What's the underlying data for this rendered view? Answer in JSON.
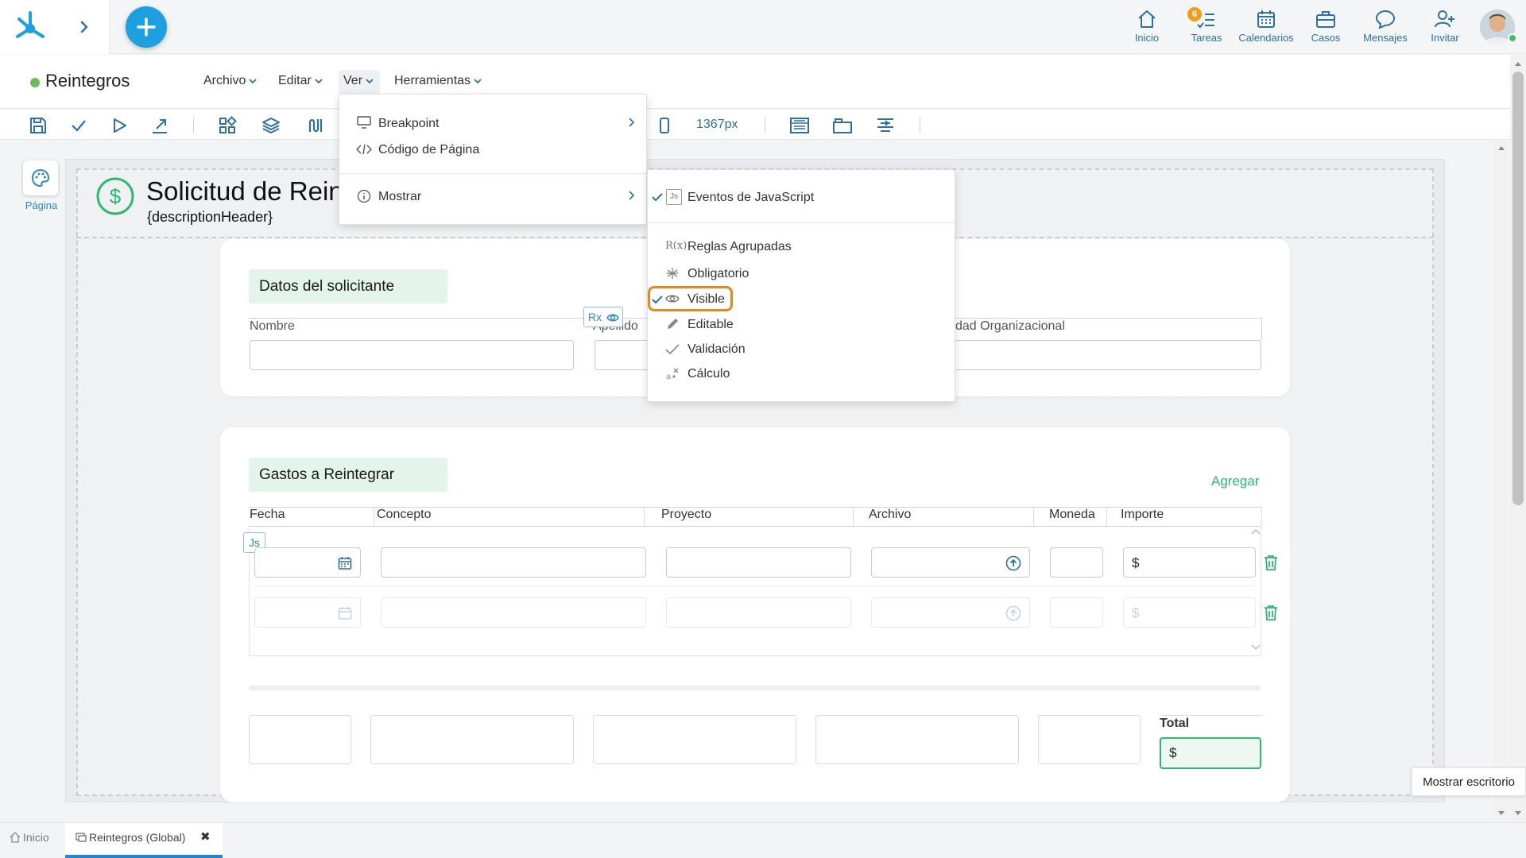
{
  "nav": {
    "items": [
      {
        "label": "Inicio",
        "icon": "home-icon"
      },
      {
        "label": "Tareas",
        "icon": "tasks-icon",
        "badge": "6"
      },
      {
        "label": "Calendarios",
        "icon": "calendar-icon"
      },
      {
        "label": "Casos",
        "icon": "briefcase-icon"
      },
      {
        "label": "Mensajes",
        "icon": "chat-icon"
      },
      {
        "label": "Invitar",
        "icon": "invite-icon"
      }
    ]
  },
  "app": {
    "title": "Reintegros"
  },
  "menus": {
    "archivo": "Archivo",
    "editar": "Editar",
    "ver": "Ver",
    "herramientas": "Herramientas"
  },
  "toolbar": {
    "width_label": "1367px"
  },
  "left_panel": {
    "pagina": "Página"
  },
  "page": {
    "title": "Solicitud de Rein",
    "description": "{descriptionHeader}"
  },
  "solicitante": {
    "title": "Datos del solicitante",
    "nombre": "Nombre",
    "apellido": "Apellido",
    "unidad": "dad Organizacional",
    "rx_tag": "Rx"
  },
  "gastos": {
    "title": "Gastos a Reintegrar",
    "agregar": "Agregar",
    "columns": [
      "Fecha",
      "Concepto",
      "Proyecto",
      "Archivo",
      "Moneda",
      "Importe"
    ],
    "js_tag": "Js",
    "currency_symbol": "$"
  },
  "totals": {
    "label": "Total",
    "currency_symbol": "$"
  },
  "ver_menu": {
    "breakpoint": "Breakpoint",
    "codigo": "Código de Página",
    "mostrar": "Mostrar"
  },
  "mostrar_menu": {
    "items": [
      {
        "label": "Eventos de JavaScript",
        "checked": true
      },
      {
        "label": "Reglas Agrupadas",
        "checked": false
      },
      {
        "label": "Obligatorio",
        "checked": false
      },
      {
        "label": "Visible",
        "checked": true
      },
      {
        "label": "Editable",
        "checked": false
      },
      {
        "label": "Validación",
        "checked": false
      },
      {
        "label": "Cálculo",
        "checked": false
      }
    ],
    "js_icon": "Js",
    "rules_icon": "R(x)"
  },
  "tooltip": "Mostrar escritorio",
  "bottom_tabs": {
    "inicio": "Inicio",
    "reintegros": "Reintegros (Global)",
    "close": "✖"
  },
  "colors": {
    "accent": "#1e9fe0",
    "green": "#2eb872",
    "highlight": "#e8861a",
    "link_blue": "#2d6fa8"
  }
}
